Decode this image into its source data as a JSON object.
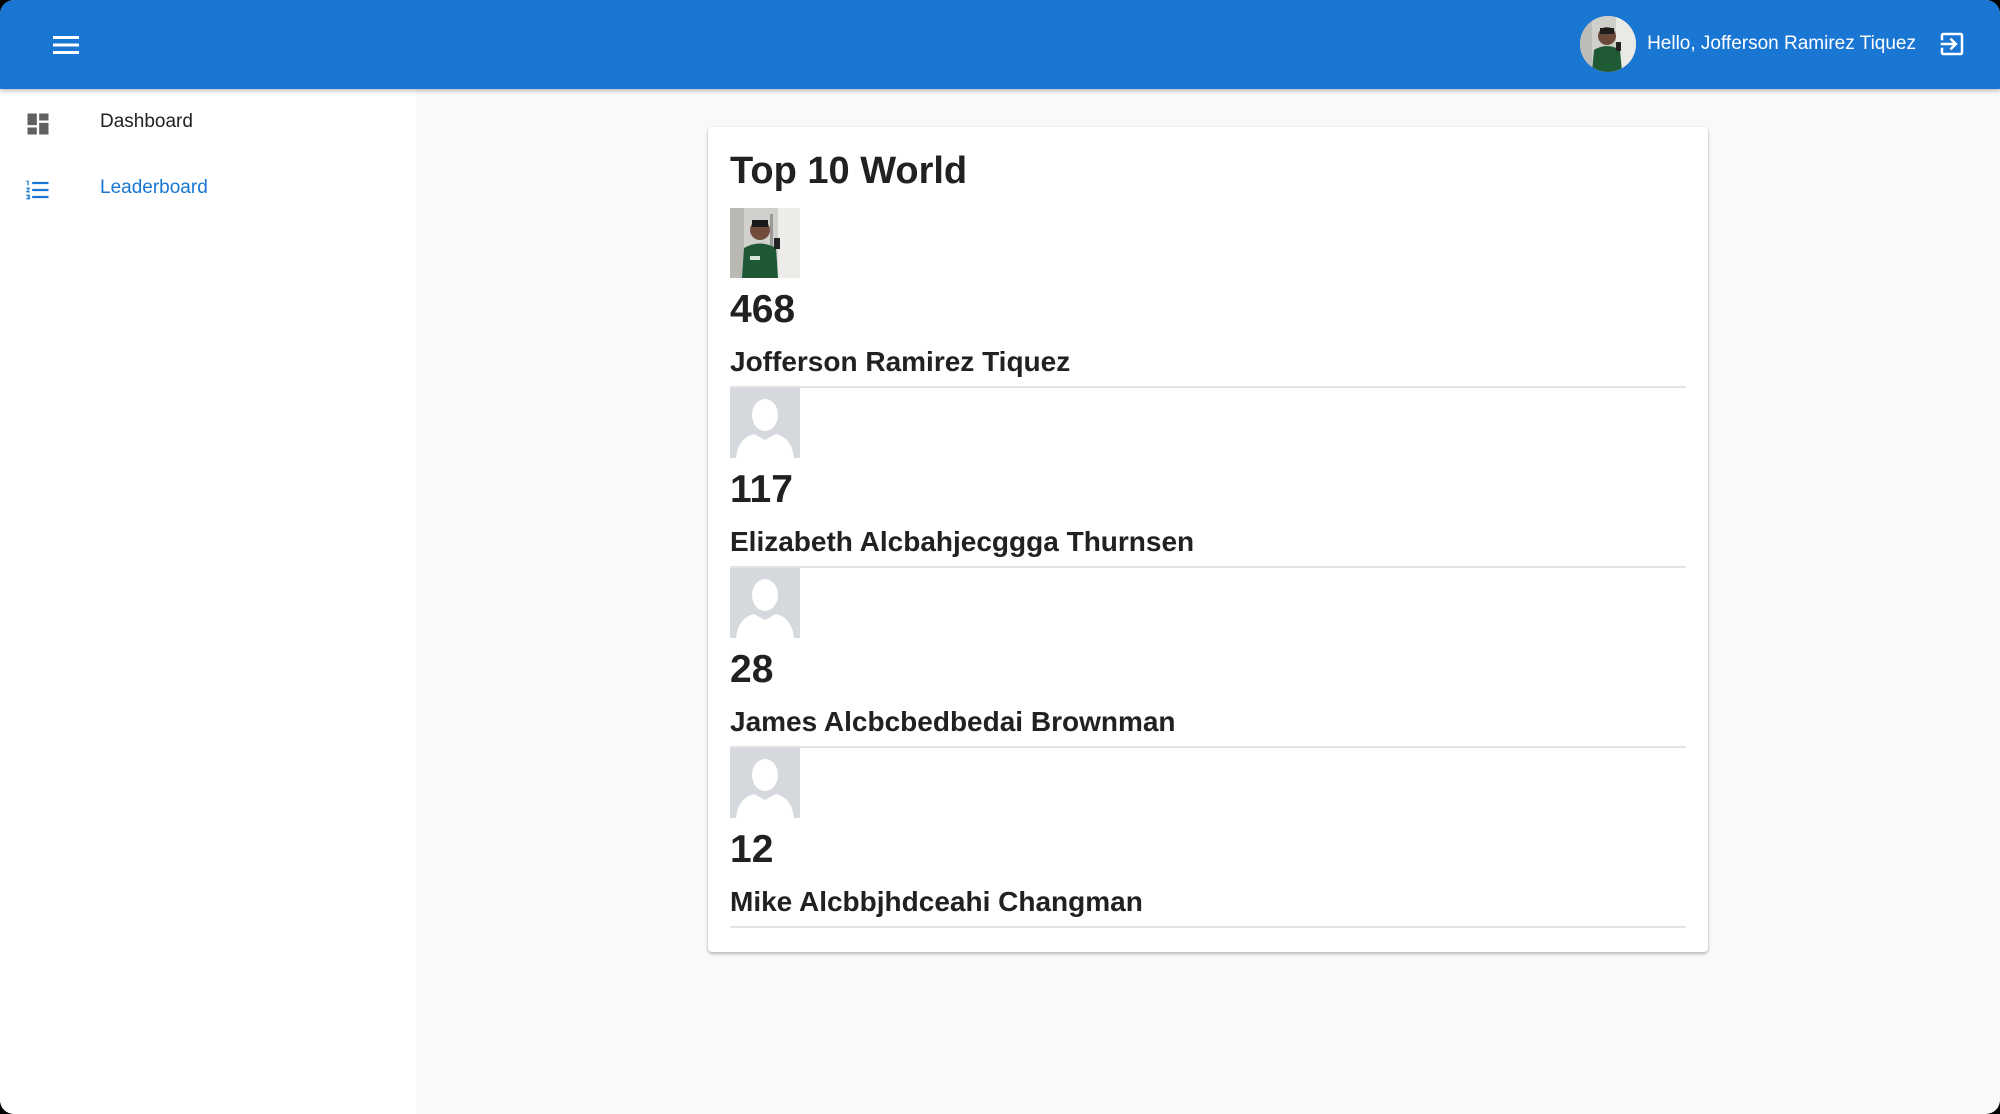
{
  "header": {
    "greeting": "Hello, Jofferson Ramirez Tiquez",
    "icons": {
      "menu": "menu-icon",
      "avatar": "user-avatar",
      "logout": "logout-icon"
    }
  },
  "sidebar": {
    "items": [
      {
        "label": "Dashboard",
        "icon": "dashboard-icon",
        "active": false
      },
      {
        "label": "Leaderboard",
        "icon": "list-icon",
        "active": true
      }
    ]
  },
  "leaderboard": {
    "title": "Top 10 World",
    "entries": [
      {
        "score": "468",
        "name": "Jofferson Ramirez Tiquez",
        "photo": "user-photo"
      },
      {
        "score": "117",
        "name": "Elizabeth Alcbahjecggga Thurnsen",
        "photo": "default-avatar"
      },
      {
        "score": "28",
        "name": "James Alcbcbedbedai Brownman",
        "photo": "default-avatar"
      },
      {
        "score": "12",
        "name": "Mike Alcbbjhdceahi Changman",
        "photo": "default-avatar"
      }
    ]
  },
  "colors": {
    "primary": "#1976d2",
    "background": "#f9f9f9",
    "text": "#212121",
    "icon_gray": "#616161",
    "placeholder_bg": "#d5d8dc"
  }
}
